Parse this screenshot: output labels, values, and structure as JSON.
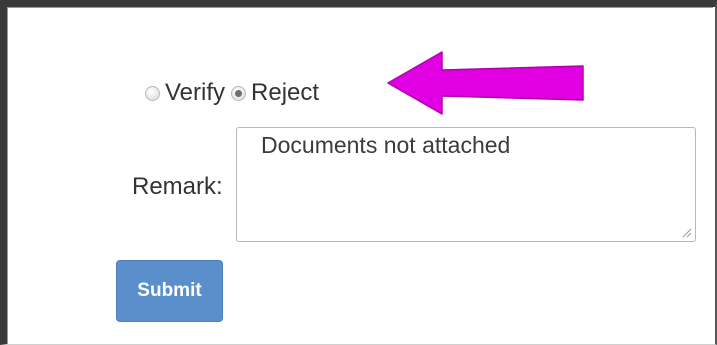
{
  "verification": {
    "options": [
      {
        "label": "Verify",
        "checked": false
      },
      {
        "label": "Reject",
        "checked": true
      }
    ],
    "selected": "Reject"
  },
  "remark": {
    "label": "Remark:",
    "value": "Documents not attached"
  },
  "actions": {
    "submit_label": "Submit"
  },
  "colors": {
    "annotation_arrow": "#e100e1",
    "submit_button": "#5b8fcc"
  },
  "icons": {
    "annotation": "left-arrow-icon",
    "textarea_resize": "resize-grip-icon"
  }
}
